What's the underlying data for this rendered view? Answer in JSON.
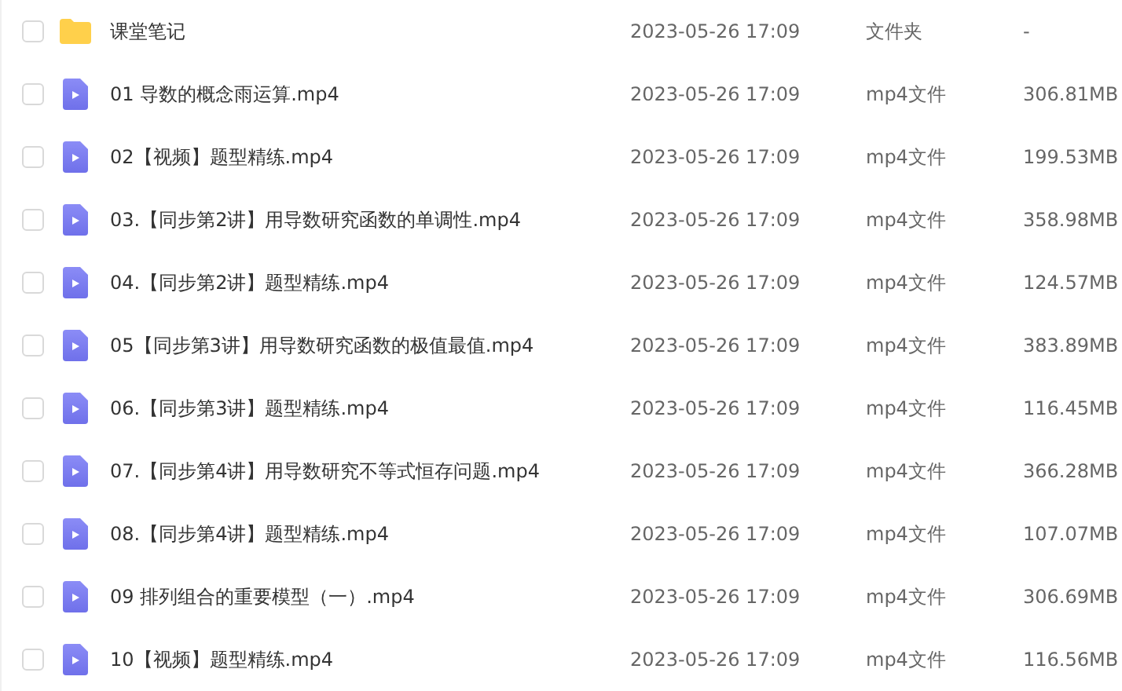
{
  "files": [
    {
      "kind": "folder",
      "checked": false,
      "name": "课堂笔记",
      "modified": "2023-05-26 17:09",
      "type": "文件夹",
      "size": "-"
    },
    {
      "kind": "video",
      "checked": false,
      "name": "01 导数的概念雨运算.mp4",
      "modified": "2023-05-26 17:09",
      "type": "mp4文件",
      "size": "306.81MB"
    },
    {
      "kind": "video",
      "checked": false,
      "name": "02【视频】题型精练.mp4",
      "modified": "2023-05-26 17:09",
      "type": "mp4文件",
      "size": "199.53MB"
    },
    {
      "kind": "video",
      "checked": false,
      "name": "03.【同步第2讲】用导数研究函数的单调性.mp4",
      "modified": "2023-05-26 17:09",
      "type": "mp4文件",
      "size": "358.98MB"
    },
    {
      "kind": "video",
      "checked": false,
      "name": "04.【同步第2讲】题型精练.mp4",
      "modified": "2023-05-26 17:09",
      "type": "mp4文件",
      "size": "124.57MB"
    },
    {
      "kind": "video",
      "checked": false,
      "name": "05【同步第3讲】用导数研究函数的极值最值.mp4",
      "modified": "2023-05-26 17:09",
      "type": "mp4文件",
      "size": "383.89MB"
    },
    {
      "kind": "video",
      "checked": false,
      "name": "06.【同步第3讲】题型精练.mp4",
      "modified": "2023-05-26 17:09",
      "type": "mp4文件",
      "size": "116.45MB"
    },
    {
      "kind": "video",
      "checked": false,
      "name": "07.【同步第4讲】用导数研究不等式恒存问题.mp4",
      "modified": "2023-05-26 17:09",
      "type": "mp4文件",
      "size": "366.28MB"
    },
    {
      "kind": "video",
      "checked": false,
      "name": "08.【同步第4讲】题型精练.mp4",
      "modified": "2023-05-26 17:09",
      "type": "mp4文件",
      "size": "107.07MB"
    },
    {
      "kind": "video",
      "checked": false,
      "name": "09 排列组合的重要模型（一）.mp4",
      "modified": "2023-05-26 17:09",
      "type": "mp4文件",
      "size": "306.69MB"
    },
    {
      "kind": "video",
      "checked": false,
      "name": "10【视频】题型精练.mp4",
      "modified": "2023-05-26 17:09",
      "type": "mp4文件",
      "size": "116.56MB"
    }
  ]
}
